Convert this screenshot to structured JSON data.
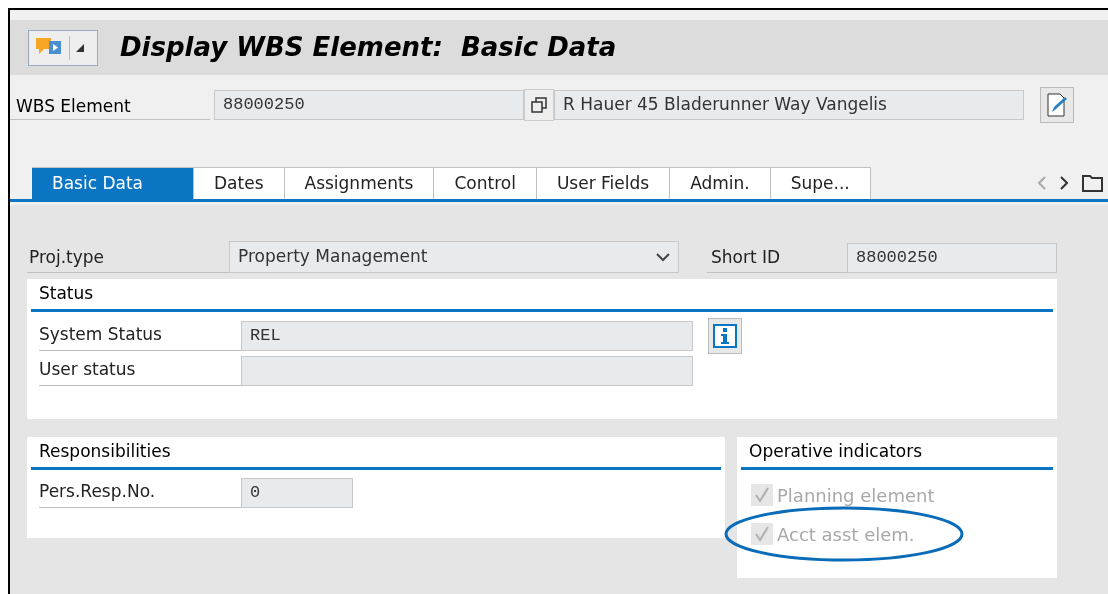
{
  "window": {
    "title": "Display WBS Element:  Basic Data"
  },
  "header": {
    "label": "WBS Element",
    "value": "88000250",
    "description": "R Hauer 45 Bladerunner Way Vangelis"
  },
  "tabs": [
    {
      "label": "Basic Data",
      "selected": true
    },
    {
      "label": "Dates",
      "selected": false
    },
    {
      "label": "Assignments",
      "selected": false
    },
    {
      "label": "Control",
      "selected": false
    },
    {
      "label": "User Fields",
      "selected": false
    },
    {
      "label": "Admin.",
      "selected": false
    },
    {
      "label": "Supe...",
      "selected": false
    }
  ],
  "proj_type": {
    "label": "Proj.type",
    "value": "Property Management"
  },
  "short_id": {
    "label": "Short ID",
    "value": "88000250"
  },
  "status": {
    "title": "Status",
    "system_status": {
      "label": "System Status",
      "value": "REL"
    },
    "user_status": {
      "label": "User status"
    }
  },
  "responsibilities": {
    "title": "Responsibilities",
    "label": "Pers.Resp.No.",
    "value": "0"
  },
  "operative_indicators": {
    "title": "Operative indicators",
    "items": [
      {
        "label": "Planning element",
        "checked": true,
        "disabled": true,
        "highlighted": false
      },
      {
        "label": "Acct asst elem.",
        "checked": true,
        "disabled": true,
        "highlighted": true
      }
    ]
  }
}
